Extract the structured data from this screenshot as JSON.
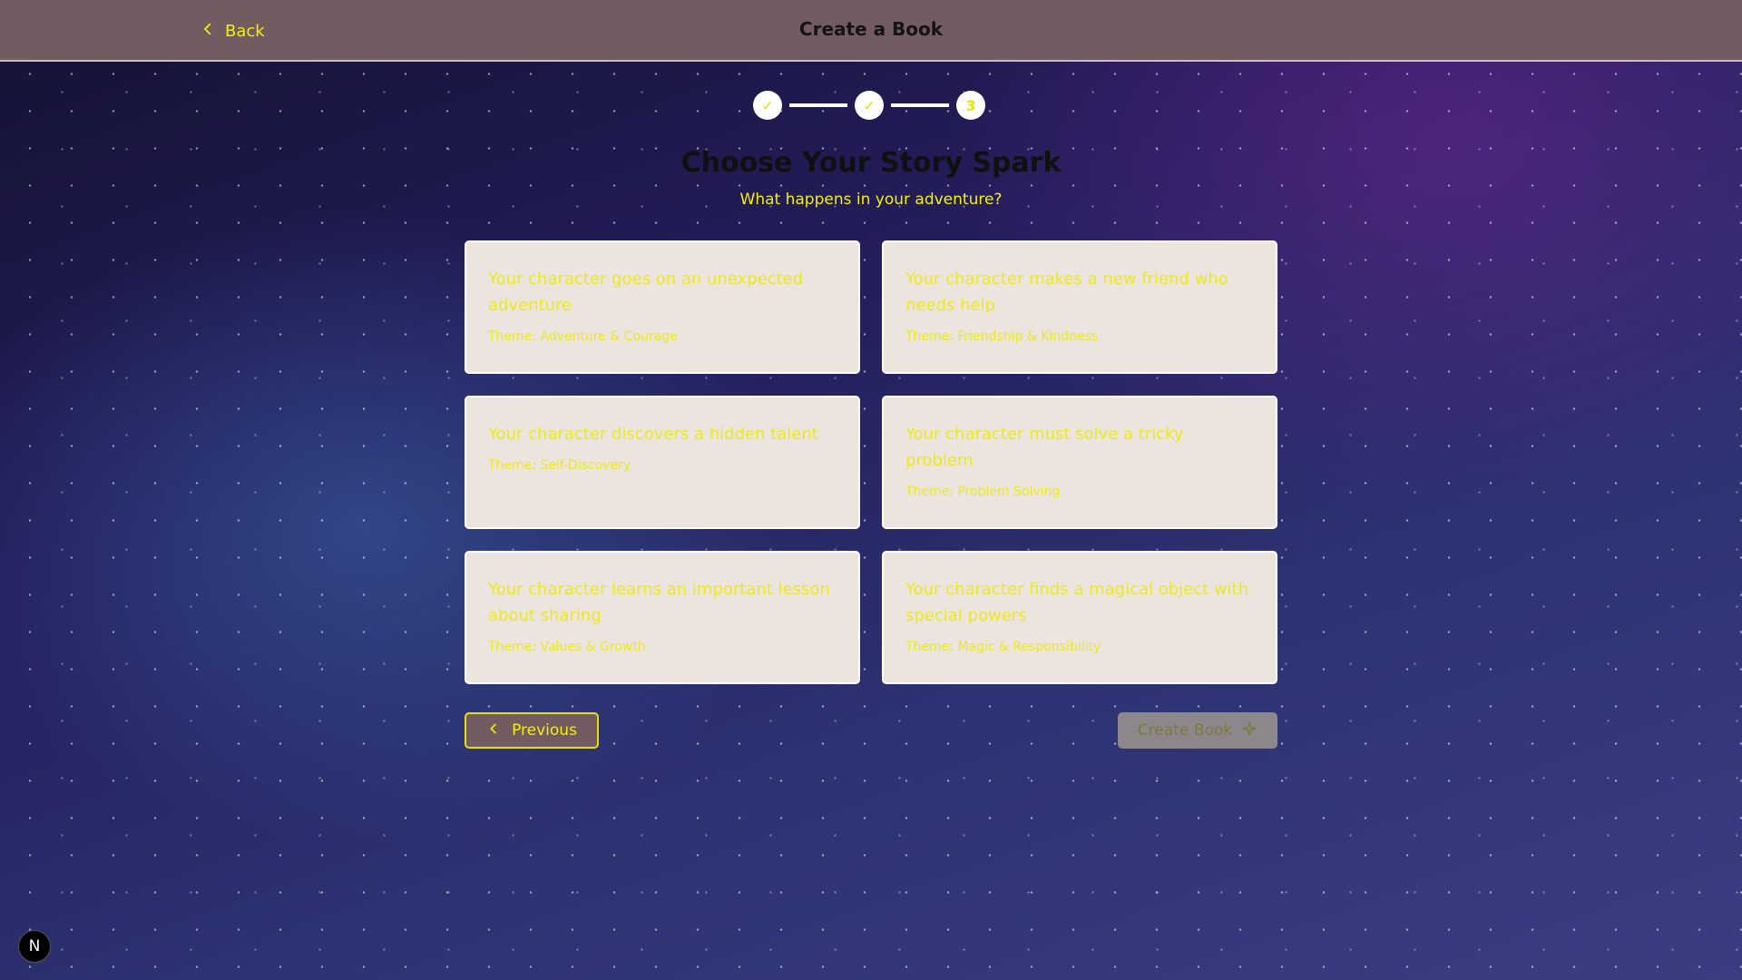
{
  "colors": {
    "header_bg": "#735b62",
    "accent_yellow": "#f5f000",
    "card_bg": "#ece4de",
    "disabled_button_bg": "#8d878c"
  },
  "header": {
    "back_label": "Back",
    "back_icon": "chevron-left-icon",
    "title": "Create a Book"
  },
  "stepper": {
    "steps": [
      {
        "label": "✓",
        "status": "completed"
      },
      {
        "label": "✓",
        "status": "completed"
      },
      {
        "label": "3",
        "status": "current"
      }
    ]
  },
  "main": {
    "title": "Choose Your Story Spark",
    "subtitle": "What happens in your adventure?"
  },
  "sparks": [
    {
      "text": "Your character goes on an unexpected adventure",
      "theme": "Theme: Adventure & Courage"
    },
    {
      "text": "Your character makes a new friend who needs help",
      "theme": "Theme: Friendship & Kindness"
    },
    {
      "text": "Your character discovers a hidden talent",
      "theme": "Theme: Self-Discovery"
    },
    {
      "text": "Your character must solve a tricky problem",
      "theme": "Theme: Problem Solving"
    },
    {
      "text": "Your character learns an important lesson about sharing",
      "theme": "Theme: Values & Growth"
    },
    {
      "text": "Your character finds a magical object with special powers",
      "theme": "Theme: Magic & Responsibility"
    }
  ],
  "actions": {
    "previous_label": "Previous",
    "previous_icon": "chevron-left-icon",
    "create_label": "Create Book",
    "create_icon": "sparkle-icon",
    "create_disabled": true
  },
  "badge": {
    "label": "N"
  }
}
